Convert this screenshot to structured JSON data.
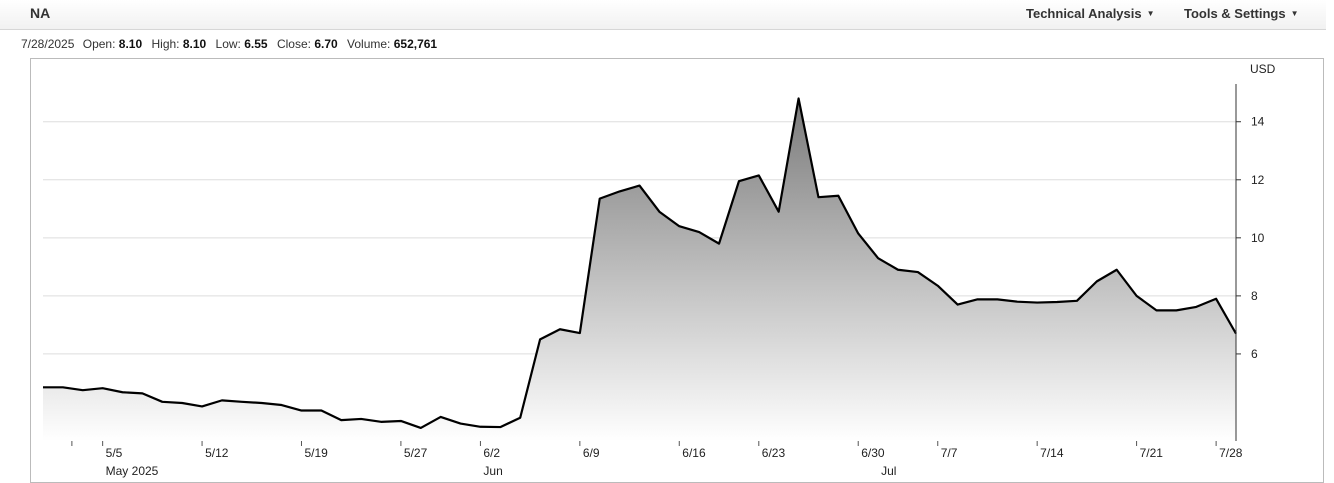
{
  "header": {
    "ticker": "NA",
    "menu_technical": "Technical Analysis",
    "menu_tools": "Tools & Settings",
    "caret": "▼"
  },
  "quote": {
    "date": "7/28/2025",
    "open_label": "Open:",
    "open": "8.10",
    "high_label": "High:",
    "high": "8.10",
    "low_label": "Low:",
    "low": "6.55",
    "close_label": "Close:",
    "close": "6.70",
    "volume_label": "Volume:",
    "volume": "652,761"
  },
  "chart_data": {
    "type": "area",
    "ylabel": "USD",
    "ylim": [
      3,
      15.3
    ],
    "yticks": [
      6,
      8,
      10,
      12,
      14
    ],
    "grid": true,
    "x": [
      "5/1",
      "5/2",
      "5/5",
      "5/6",
      "5/7",
      "5/8",
      "5/9",
      "5/12",
      "5/13",
      "5/14",
      "5/15",
      "5/16",
      "5/19",
      "5/20",
      "5/21",
      "5/22",
      "5/23",
      "5/27",
      "5/28",
      "5/29",
      "5/30",
      "6/2",
      "6/3",
      "6/4",
      "6/5",
      "6/6",
      "6/9",
      "6/10",
      "6/11",
      "6/12",
      "6/13",
      "6/16",
      "6/17",
      "6/18",
      "6/20",
      "6/23",
      "6/24",
      "6/25",
      "6/26",
      "6/27",
      "6/30",
      "7/1",
      "7/2",
      "7/3",
      "7/7",
      "7/8",
      "7/9",
      "7/10",
      "7/11",
      "7/14",
      "7/15",
      "7/16",
      "7/17",
      "7/18",
      "7/21",
      "7/22",
      "7/23",
      "7/24",
      "7/25",
      "7/28"
    ],
    "series": [
      {
        "values": [
          4.85,
          4.85,
          4.75,
          4.82,
          4.68,
          4.64,
          4.35,
          4.31,
          4.19,
          4.4,
          4.35,
          4.31,
          4.24,
          4.05,
          4.05,
          3.72,
          3.76,
          3.66,
          3.69,
          3.45,
          3.83,
          3.6,
          3.49,
          3.48,
          3.8,
          6.5,
          6.85,
          6.72,
          11.35,
          11.6,
          11.8,
          10.9,
          10.4,
          10.2,
          9.8,
          11.95,
          12.15,
          10.9,
          14.8,
          11.4,
          11.45,
          10.15,
          9.3,
          8.9,
          8.82,
          8.35,
          7.7,
          7.88,
          7.88,
          7.8,
          7.77,
          7.79,
          7.83,
          8.5,
          8.9,
          8.0,
          7.5,
          7.5,
          7.62,
          7.9,
          6.7
        ]
      }
    ],
    "xtick_labels": [
      {
        "label": "5/5",
        "index": 3
      },
      {
        "label": "5/12",
        "index": 8
      },
      {
        "label": "5/19",
        "index": 13
      },
      {
        "label": "5/27",
        "index": 18
      },
      {
        "label": "6/2",
        "index": 22
      },
      {
        "label": "6/9",
        "index": 27
      },
      {
        "label": "6/16",
        "index": 32
      },
      {
        "label": "6/23",
        "index": 36
      },
      {
        "label": "6/30",
        "index": 41
      },
      {
        "label": "7/7",
        "index": 45
      },
      {
        "label": "7/14",
        "index": 50
      },
      {
        "label": "7/21",
        "index": 55
      },
      {
        "label": "7/28",
        "index": 59
      }
    ],
    "month_labels": [
      {
        "label": "May 2025",
        "index": 3
      },
      {
        "label": "Jun",
        "index": 22
      },
      {
        "label": "Jul",
        "index": 42
      }
    ],
    "line_color": "#000000",
    "fill_top": "#7a7a7a",
    "fill_bottom": "#ffffff"
  }
}
